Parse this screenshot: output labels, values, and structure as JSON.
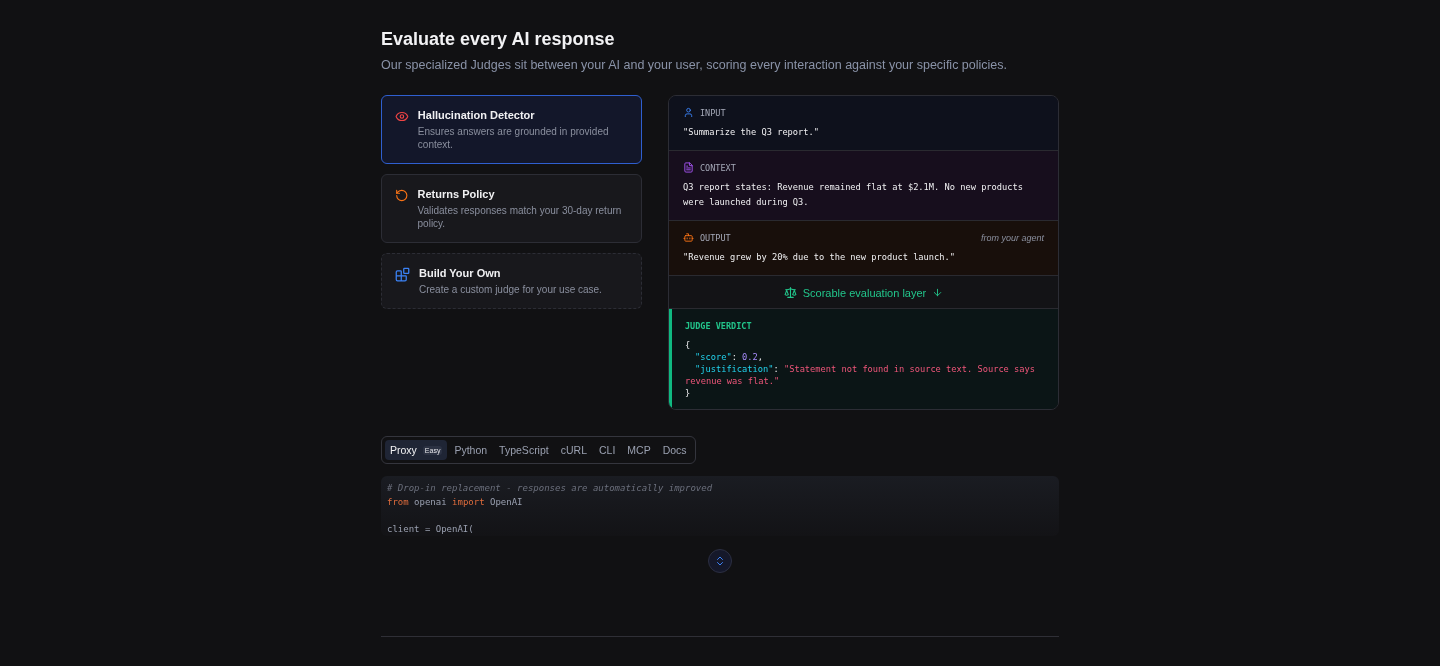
{
  "header": {
    "title": "Evaluate every AI response",
    "subtitle": "Our specialized Judges sit between your AI and your user, scoring every interaction against your specific policies."
  },
  "judges": [
    {
      "kind": "eye",
      "title": "Hallucination Detector",
      "description": "Ensures answers are grounded in provided context.",
      "selected": true,
      "custom": false
    },
    {
      "kind": "returns",
      "title": "Returns Policy",
      "description": "Validates responses match your 30-day return policy.",
      "selected": false,
      "custom": false
    },
    {
      "kind": "build",
      "title": "Build Your Own",
      "description": "Create a custom judge for your use case.",
      "selected": false,
      "custom": true
    }
  ],
  "flow": {
    "sections": [
      {
        "kind": "input",
        "label": "INPUT",
        "text": "\"Summarize the Q3 report.\""
      },
      {
        "kind": "context",
        "label": "CONTEXT",
        "text": "Q3 report states: Revenue remained flat at $2.1M. No new products were launched during Q3."
      },
      {
        "kind": "output",
        "label": "OUTPUT",
        "note": "from your agent",
        "text": "\"Revenue grew by 20% due to the new product launch.\""
      }
    ],
    "layer": "Scorable evaluation layer",
    "verdict": {
      "label": "JUDGE VERDICT",
      "lines": [
        [
          {
            "kind": "punct",
            "text": "{"
          }
        ],
        [
          {
            "kind": "key",
            "text": "\"score\""
          },
          {
            "kind": "punct",
            "text": ": "
          },
          {
            "kind": "number",
            "text": "0.2"
          },
          {
            "kind": "punct",
            "text": ","
          }
        ],
        [
          {
            "kind": "key",
            "text": "\"justification\""
          },
          {
            "kind": "punct",
            "text": ": "
          },
          {
            "kind": "string",
            "text": "\"Statement not found in source text. Source says revenue was flat.\""
          }
        ],
        [
          {
            "kind": "punct",
            "text": "}"
          }
        ]
      ]
    }
  },
  "tabs": [
    {
      "label": "Proxy",
      "badge": "Easy",
      "selected": true
    },
    {
      "label": "Python",
      "selected": false
    },
    {
      "label": "TypeScript",
      "selected": false
    },
    {
      "label": "cURL",
      "selected": false
    },
    {
      "label": "CLI",
      "selected": false
    },
    {
      "label": "MCP",
      "selected": false
    },
    {
      "label": "Docs",
      "selected": false
    }
  ],
  "code": [
    [
      {
        "kind": "comment",
        "text": "# Drop-in replacement - responses are automatically improved"
      }
    ],
    [
      {
        "kind": "keyword",
        "text": "from"
      },
      {
        "kind": "plain",
        "text": " openai "
      },
      {
        "kind": "keyword",
        "text": "import"
      },
      {
        "kind": "plain",
        "text": " OpenAI"
      }
    ],
    [
      {
        "kind": "plain",
        "text": "client = OpenAI("
      }
    ]
  ]
}
